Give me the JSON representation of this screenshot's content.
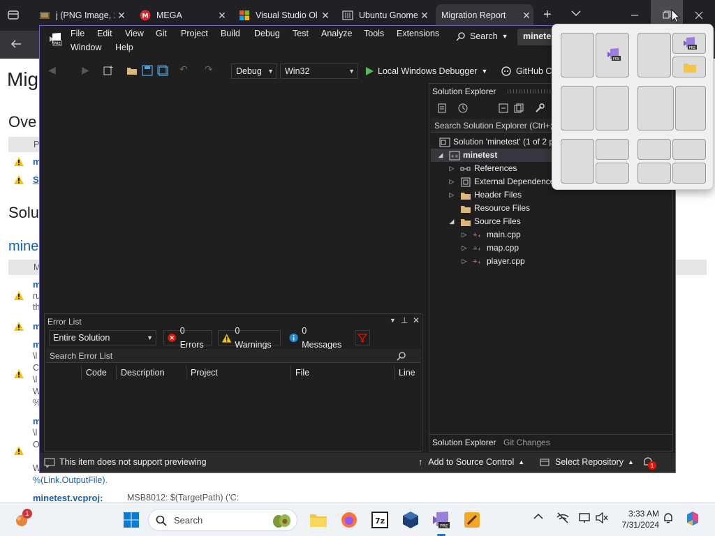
{
  "browser": {
    "tabs": [
      {
        "title": "j (PNG Image, 2"
      },
      {
        "title": "MEGA"
      },
      {
        "title": "Visual Studio Ol"
      },
      {
        "title": "Ubuntu Gnome"
      },
      {
        "title": "Migration Report"
      }
    ],
    "new_tab": "+",
    "close_glyph": "✕"
  },
  "report": {
    "title": "Mig",
    "overview_heading": "Ove",
    "col_p": "P",
    "row1_link": "m",
    "row2_link": "S",
    "solution_heading": "Solu",
    "mine_heading": "mine",
    "table_col": "M",
    "frag_m": "m",
    "frag_ru": "ru",
    "frag_th": "th",
    "frag_slash1": "\\l",
    "frag_C": "C",
    "frag_slash2": "\\l",
    "frag_W": "W",
    "frag_pct": "%",
    "frag_O": "O",
    "frag_slash3": "\\l",
    "frag_W2": "W",
    "output_file": "%(Link.OutputFile).",
    "bottom_link": "minetest.vcproj:",
    "bottom_text": "MSB8012: $(TargetPath) ('C:"
  },
  "vs": {
    "menu": [
      "File",
      "Edit",
      "View",
      "Git",
      "Project",
      "Build",
      "Debug",
      "Test",
      "Analyze",
      "Tools",
      "Extensions"
    ],
    "menu_row2": [
      "Window",
      "Help"
    ],
    "search_label": "Search",
    "solution_name_badge": "minetest",
    "config": "Debug",
    "platform": "Win32",
    "run_target": "Local Windows Debugger",
    "github": "GitHub Co",
    "solution_explorer": {
      "title": "Solution Explorer",
      "search_placeholder": "Search Solution Explorer (Ctrl+;)",
      "solution_node": "Solution 'minetest' (1 of 2 p",
      "project_node": "minetest",
      "items": [
        "References",
        "External Dependence",
        "Header Files",
        "Resource Files",
        "Source Files"
      ],
      "source_files": [
        "main.cpp",
        "map.cpp",
        "player.cpp"
      ],
      "bottom_tabs": [
        "Solution Explorer",
        "Git Changes"
      ]
    },
    "error_list": {
      "title": "Error List",
      "scope": "Entire Solution",
      "errors": "0 Errors",
      "warnings": "0 Warnings",
      "messages": "0 Messages",
      "search_placeholder": "Search Error List",
      "columns": [
        "Code",
        "Description",
        "Project",
        "File",
        "Line"
      ]
    },
    "status": {
      "preview": "This item does not support previewing",
      "source_control": "Add to Source Control",
      "repository": "Select Repository",
      "notifications": "1"
    }
  },
  "taskbar": {
    "search": "Search",
    "time": "3:33 AM",
    "date": "7/31/2024",
    "weather_badge": "1"
  }
}
